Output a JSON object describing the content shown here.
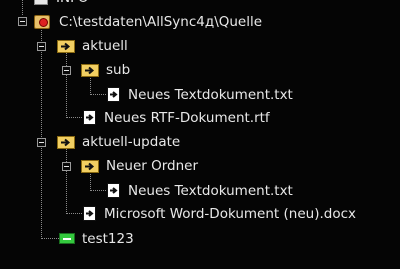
{
  "tree": {
    "info_label": "INFO",
    "root_label": "C:\\testdaten\\AllSync4д\\Quelle",
    "aktuell_label": "aktuell",
    "sub_label": "sub",
    "sub_file_label": "Neues Textdokument.txt",
    "aktuell_file_label": "Neues RTF-Dokument.rtf",
    "aktuell_update_label": "aktuell-update",
    "neuer_ordner_label": "Neuer Ordner",
    "neuer_ordner_file_label": "Neues Textdokument.txt",
    "update_file_label": "Microsoft Word-Dokument (neu).docx",
    "test_label": "test123"
  },
  "icons": {
    "info": "info-icon",
    "root": "drive-icon",
    "folder": "folder-arrow-icon",
    "file": "file-arrow-icon",
    "test": "green-minus-icon"
  },
  "colors": {
    "background": "#050505",
    "folder": "#f2cf62",
    "root_badge": "#d22222",
    "test_badge": "#34c93e",
    "text": "#e8e8e8"
  }
}
